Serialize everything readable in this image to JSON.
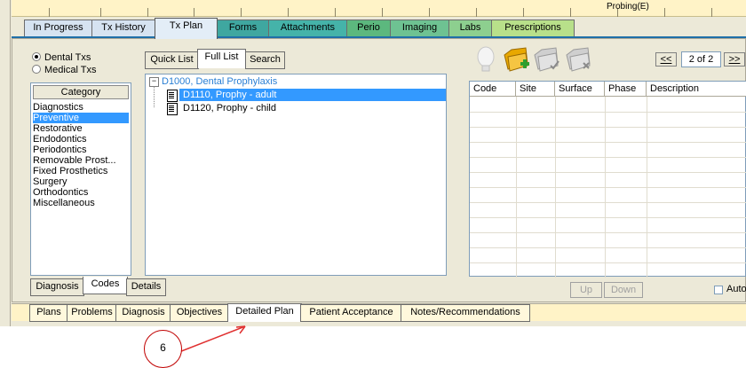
{
  "top_strip_text": "Probing(E)",
  "tabs": [
    {
      "label": "In Progress",
      "color": "#D6E3F1"
    },
    {
      "label": "Tx History",
      "color": "#D6E3F1"
    },
    {
      "label": "Tx Plan",
      "color": "#E3EDF7",
      "selected": true
    },
    {
      "label": "Forms",
      "color": "#3FA7A0"
    },
    {
      "label": "Attachments",
      "color": "#45B3A9"
    },
    {
      "label": "Perio",
      "color": "#5CB87E"
    },
    {
      "label": "Imaging",
      "color": "#6EC292"
    },
    {
      "label": "Labs",
      "color": "#8DCF8F"
    },
    {
      "label": "Prescriptions",
      "color": "#B8E08A"
    }
  ],
  "tx_type": {
    "options": [
      "Dental Txs",
      "Medical Txs"
    ],
    "selected": "Dental Txs"
  },
  "category": {
    "header": "Category",
    "items": [
      "Diagnostics",
      "Preventive",
      "Restorative",
      "Endodontics",
      "Periodontics",
      "Removable Prost...",
      "Fixed Prosthetics",
      "Surgery",
      "Orthodontics",
      "Miscellaneous"
    ],
    "selected": "Preventive"
  },
  "search_tabs": [
    "Quick List",
    "Full List",
    "Search"
  ],
  "search_tab_selected": "Full List",
  "tree": {
    "group": "D1000, Dental Prophylaxis",
    "items": [
      {
        "label": "D1110, Prophy - adult",
        "selected": true
      },
      {
        "label": "D1120, Prophy - child",
        "selected": false
      }
    ]
  },
  "left_bottom_tabs": [
    "Diagnosis",
    "Codes",
    "Details"
  ],
  "left_bottom_selected": "Codes",
  "toolbar": {
    "icons": [
      "lightbulb-icon",
      "add-folder-icon",
      "approve-folder-icon",
      "delete-folder-icon"
    ],
    "pager_prev": "<<",
    "pager_value": "2 of 2",
    "pager_next": ">>"
  },
  "grid": {
    "columns": [
      "Code",
      "Site",
      "Surface",
      "Phase",
      "Description"
    ]
  },
  "buttons": {
    "up": "Up",
    "down": "Down",
    "auto": "Auto"
  },
  "bottom_tabs": [
    "Plans",
    "Problems",
    "Diagnosis",
    "Objectives",
    "Detailed Plan",
    "Patient Acceptance",
    "Notes/Recommendations"
  ],
  "bottom_tab_selected": "Detailed Plan",
  "annotation": {
    "number": "6",
    "color": "#C00000"
  }
}
